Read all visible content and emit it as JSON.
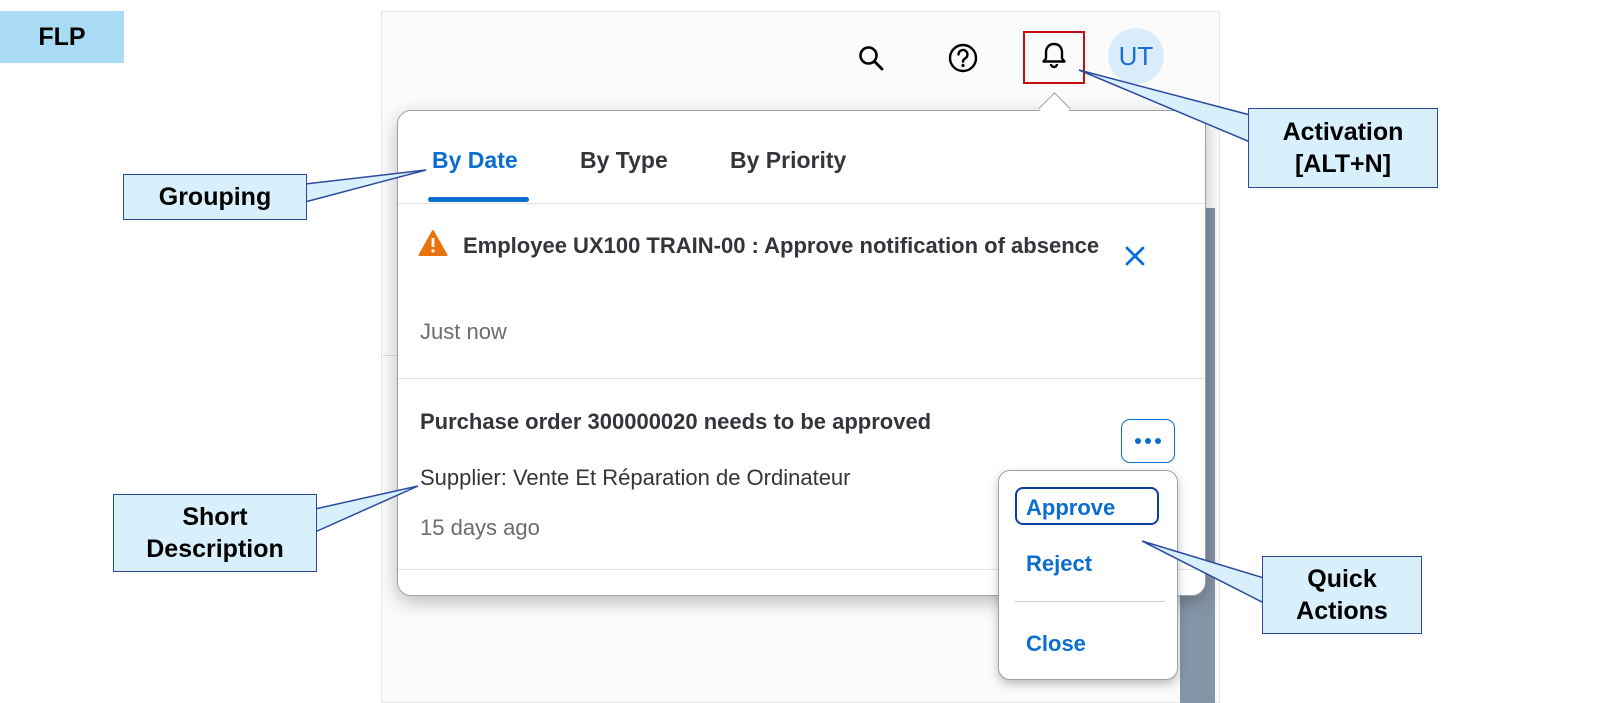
{
  "badge": {
    "label": "FLP"
  },
  "shell": {
    "icons": [
      "search-icon",
      "help-icon",
      "bell-icon"
    ],
    "avatar_initials": "UT"
  },
  "popover": {
    "tabs": [
      {
        "label": "By Date",
        "active": true
      },
      {
        "label": "By Type",
        "active": false
      },
      {
        "label": "By Priority",
        "active": false
      }
    ],
    "notifications": [
      {
        "priority_icon": "warning-icon",
        "title": "Employee UX100 TRAIN-00 : Approve notification of absence",
        "time": "Just now"
      },
      {
        "title": "Purchase order 300000020 needs to be approved",
        "description": "Supplier: Vente Et Réparation de Ordinateur",
        "time": "15 days ago"
      }
    ]
  },
  "quick_actions": {
    "items": [
      {
        "label": "Approve"
      },
      {
        "label": "Reject"
      },
      {
        "label": "Close"
      }
    ]
  },
  "callouts": {
    "grouping": "Grouping",
    "short_description": [
      "Short",
      "Description"
    ],
    "activation": [
      "Activation",
      "[ALT+N]"
    ],
    "quick_actions": [
      "Quick",
      "Actions"
    ]
  },
  "colors": {
    "accent": "#0a6ed1",
    "callout_fill": "#d8effc",
    "badge_fill": "#a9dbf5",
    "highlight_border": "#c40f0f",
    "warning": "#e9730c"
  }
}
